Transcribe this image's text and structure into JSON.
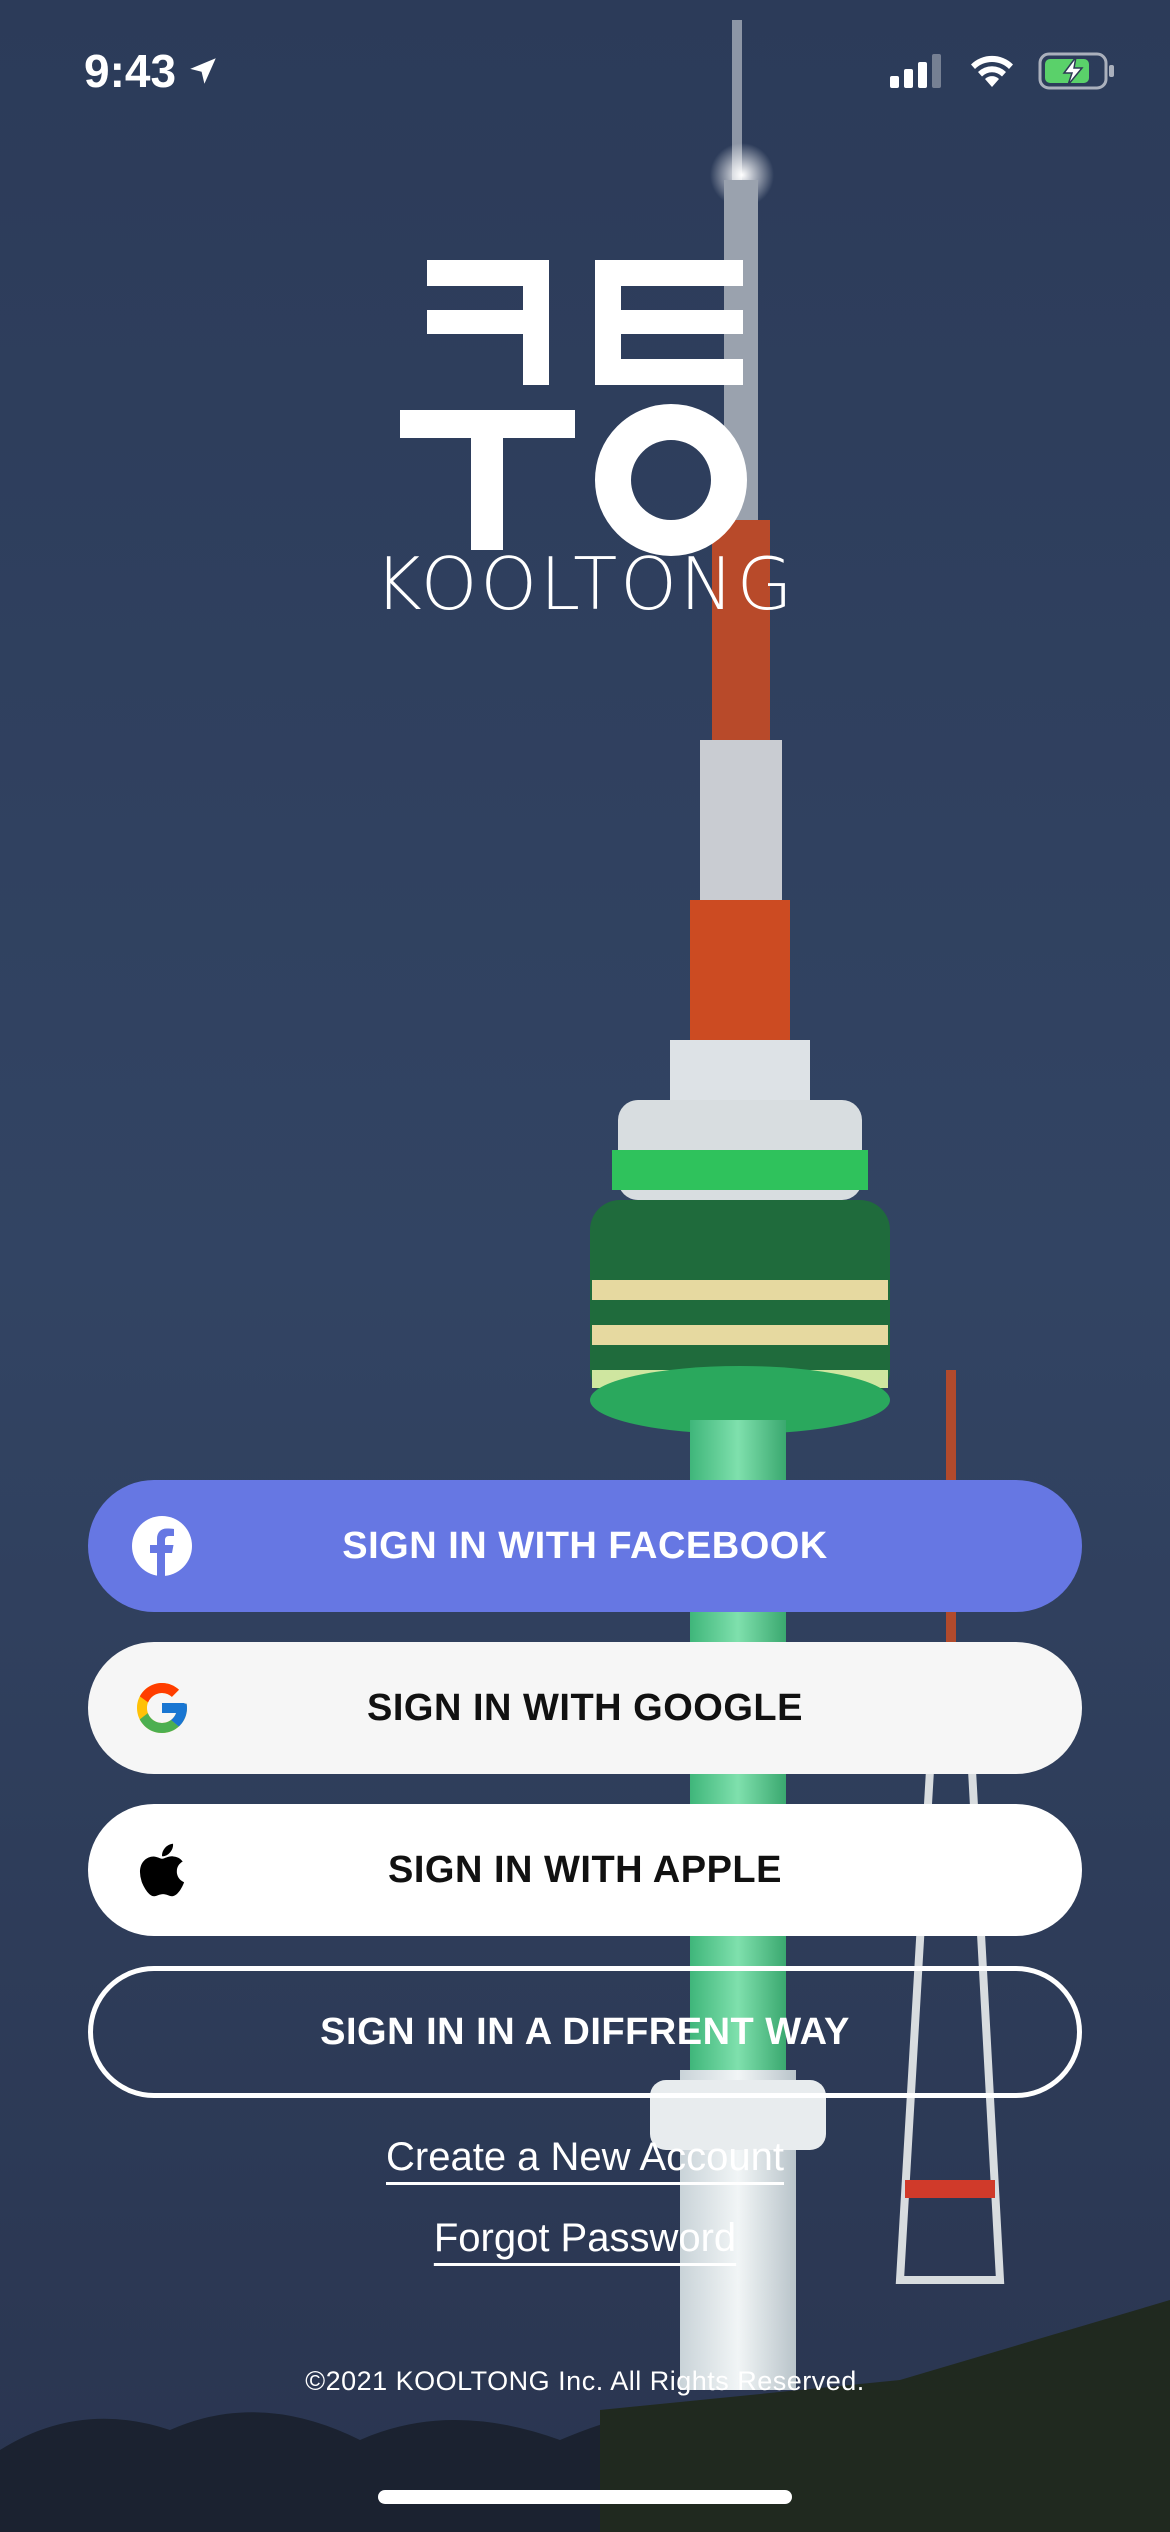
{
  "status_bar": {
    "time": "9:43",
    "location_icon": "location-arrow-icon",
    "signal_icon": "cellular-signal-icon",
    "wifi_icon": "wifi-icon",
    "battery_icon": "battery-charging-icon",
    "battery_color": "#5ad16a"
  },
  "logo": {
    "name": "KOOLTONG",
    "icon": "kooltong-logo-mark"
  },
  "buttons": {
    "facebook": {
      "label": "SIGN IN WITH FACEBOOK",
      "icon": "facebook-icon",
      "color": "#6677e3"
    },
    "google": {
      "label": "SIGN IN WITH GOOGLE",
      "icon": "google-icon",
      "color": "#f6f6f6"
    },
    "apple": {
      "label": "SIGN IN WITH APPLE",
      "icon": "apple-icon",
      "color": "#ffffff"
    },
    "other": {
      "label": "SIGN IN IN A DIFFRENT WAY"
    }
  },
  "links": {
    "create_account": "Create a New Account",
    "forgot_password": "Forgot Password"
  },
  "footer": {
    "copyright": "©2021 KOOLTONG Inc. All Rights Reserved."
  }
}
